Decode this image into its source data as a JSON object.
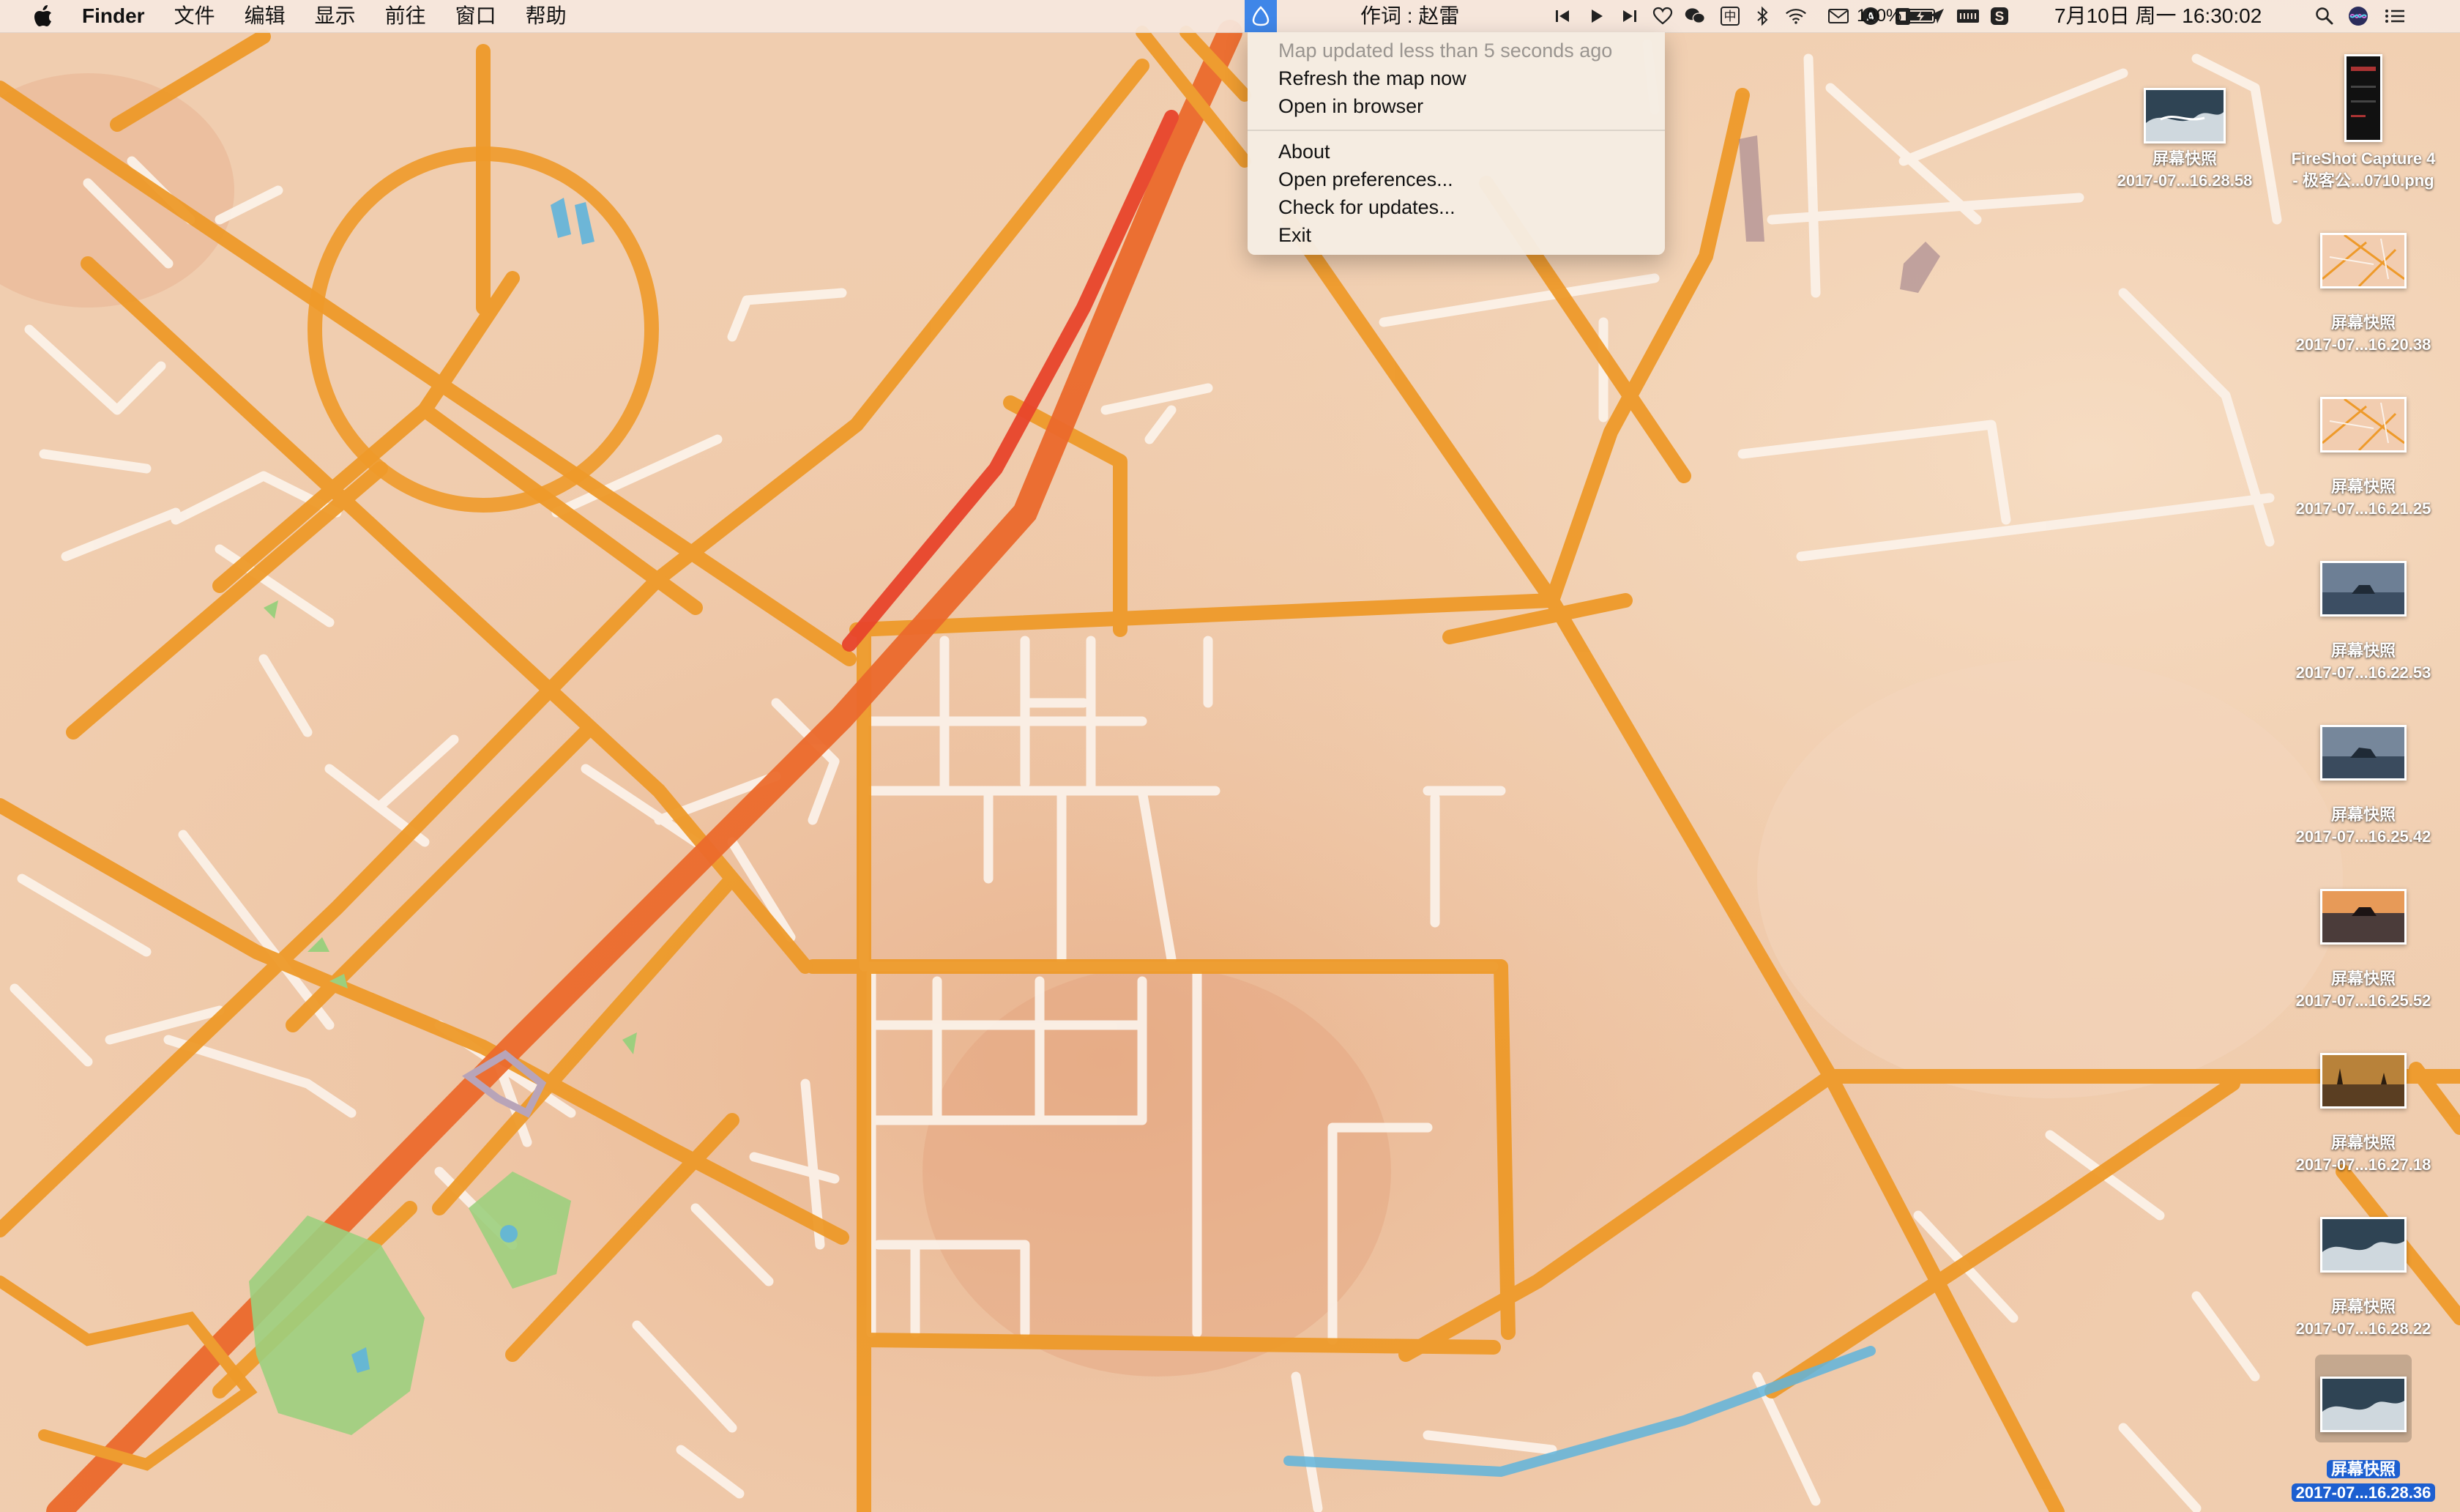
{
  "menubar": {
    "app_name": "Finder",
    "menus": [
      "文件",
      "编辑",
      "显示",
      "前往",
      "窗口",
      "帮助"
    ],
    "lyric": "作词 : 赵雷",
    "battery": "100%",
    "clock": "7月10日 周一  16:30:02",
    "status_icons": [
      "mail-icon",
      "text-input-a-icon",
      "clipboard-icon",
      "location-arrow-icon",
      "map-status-icon",
      "previous-track-icon",
      "play-icon",
      "next-track-icon",
      "heart-icon",
      "wechat-icon",
      "input-method-icon",
      "bluetooth-icon",
      "wifi-icon",
      "battery-icon",
      "keyboard-icon",
      "sogou-icon",
      "spotlight-icon",
      "siri-icon",
      "notification-center-icon"
    ]
  },
  "dropdown_menu": {
    "status": "Map updated less than 5 seconds ago",
    "items": [
      "Refresh the map now",
      "Open in browser",
      "About",
      "Open preferences...",
      "Check for updates...",
      "Exit"
    ]
  },
  "desktop_icons": [
    {
      "line1": "屏幕快照",
      "line2": "2017-07...16.28.58",
      "thumb": "dark-sea-photo"
    },
    {
      "line1": "FireShot Capture 4",
      "line2": "- 极客公...0710.png",
      "thumb": "phone-screenshot"
    },
    {
      "line1": "屏幕快照",
      "line2": "2017-07...16.20.38",
      "thumb": "map-screenshot"
    },
    {
      "line1": "屏幕快照",
      "line2": "2017-07...16.21.25",
      "thumb": "map-screenshot"
    },
    {
      "line1": "屏幕快照",
      "line2": "2017-07...16.22.53",
      "thumb": "sea-rock-photo"
    },
    {
      "line1": "屏幕快照",
      "line2": "2017-07...16.25.42",
      "thumb": "sea-rock-photo"
    },
    {
      "line1": "屏幕快照",
      "line2": "2017-07...16.25.52",
      "thumb": "sunset-rock-photo"
    },
    {
      "line1": "屏幕快照",
      "line2": "2017-07...16.27.18",
      "thumb": "golden-landscape-photo"
    },
    {
      "line1": "屏幕快照",
      "line2": "2017-07...16.28.22",
      "thumb": "dark-sea-photo"
    },
    {
      "line1": "屏幕快照",
      "line2": "2017-07...16.28.36",
      "thumb": "dark-sea-photo",
      "selected": true
    }
  ],
  "colors": {
    "map_background": "#f1cfb0",
    "major_road": "#ee9a2a",
    "highway": "#e8502a",
    "minor_road": "#fbf2ea",
    "park": "#9ccf7e",
    "water": "#5fb4dc",
    "selection": "#1d5fd0"
  }
}
